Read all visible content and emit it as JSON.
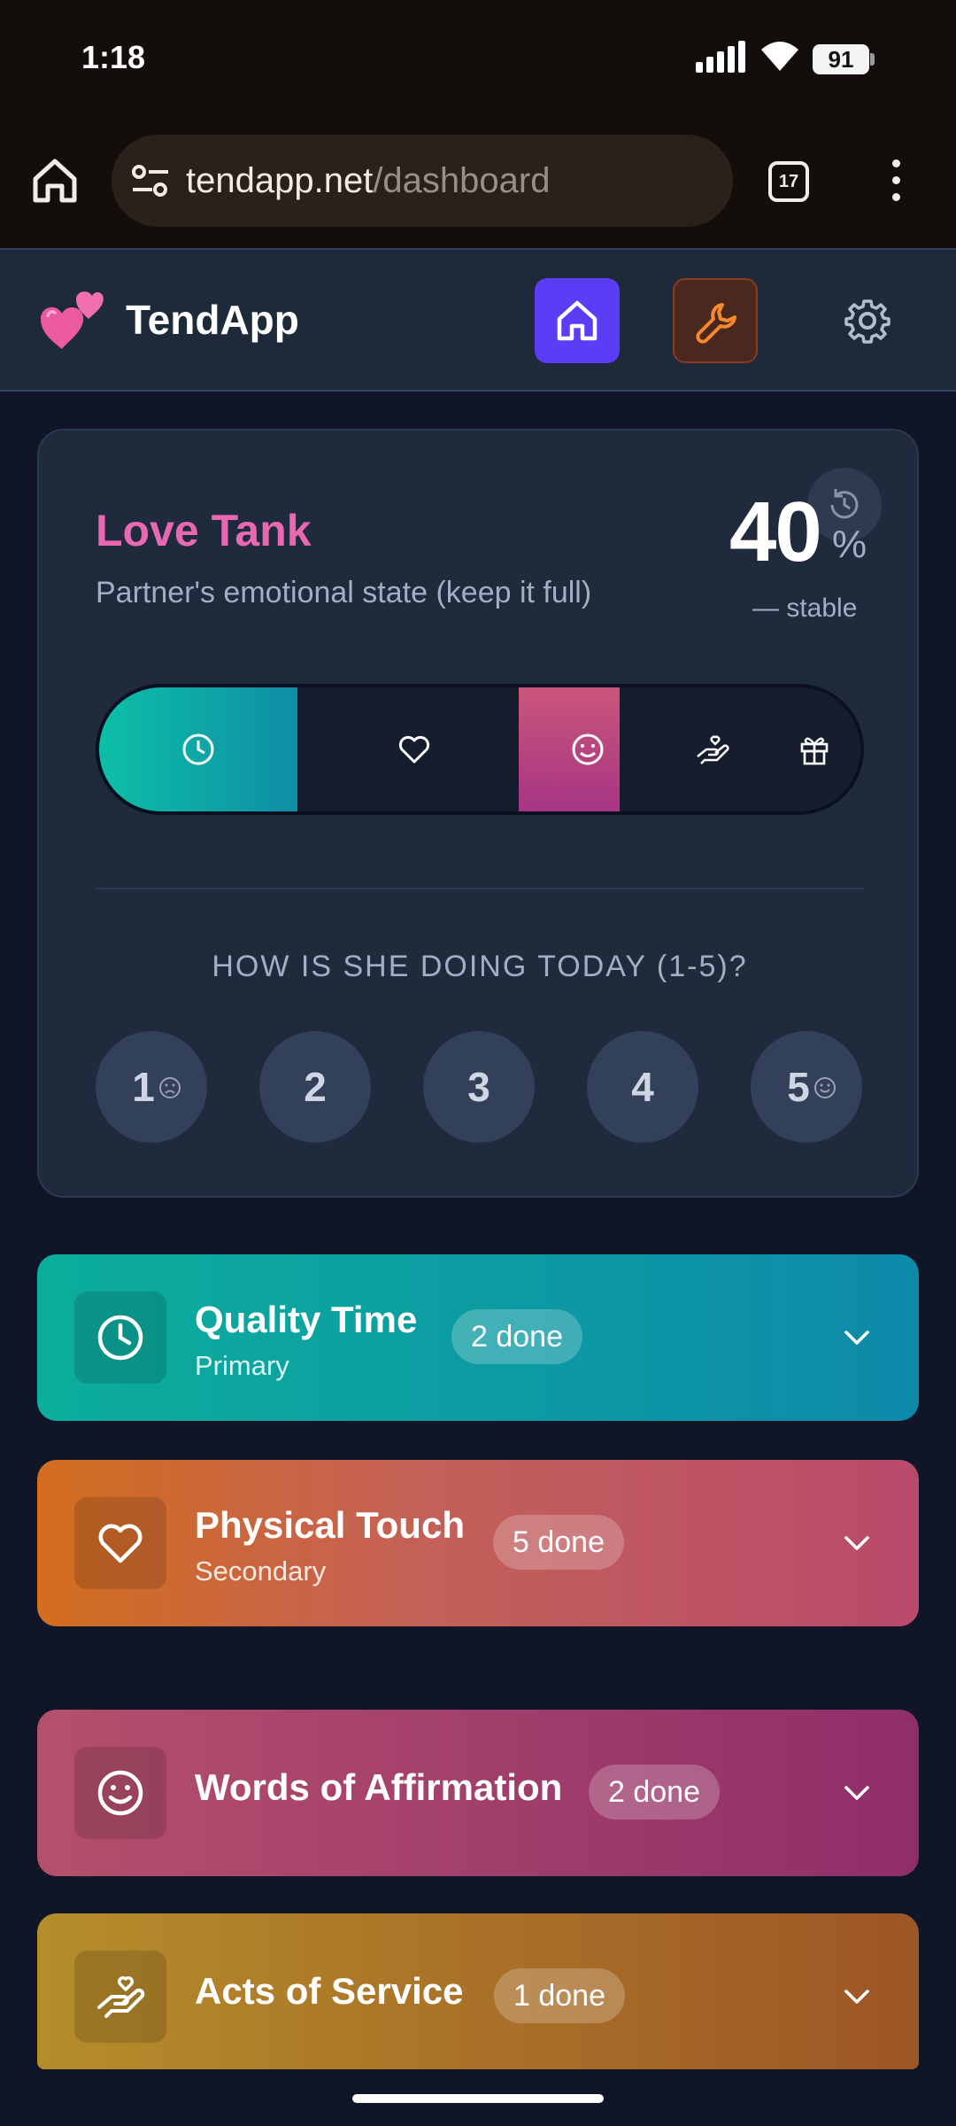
{
  "status_bar": {
    "time": "1:18",
    "battery": "91"
  },
  "browser": {
    "url_domain": "tendapp.net",
    "url_path": "/dashboard",
    "tab_count": "17"
  },
  "app": {
    "title": "TendApp"
  },
  "love_tank": {
    "title": "Love Tank",
    "subtitle": "Partner's emotional state (keep it full)",
    "percent": "40",
    "percent_sign": "%",
    "trend": "— stable",
    "fill_percent": 40,
    "rating_question": "HOW IS SHE DOING TODAY (1-5)?",
    "ratings": [
      "1",
      "2",
      "3",
      "4",
      "5"
    ]
  },
  "categories": [
    {
      "name": "Quality Time",
      "role": "Primary",
      "badge": "2 done",
      "icon": "clock-icon"
    },
    {
      "name": "Physical Touch",
      "role": "Secondary",
      "badge": "5 done",
      "icon": "heart-icon"
    },
    {
      "name": "Words of Affirmation",
      "role": "",
      "badge": "2 done",
      "icon": "smile-icon"
    },
    {
      "name": "Acts of Service",
      "role": "",
      "badge": "1 done",
      "icon": "helping-hand-icon"
    }
  ],
  "colors": {
    "accent_pink": "#e968b2",
    "home_button": "#5a3ef5",
    "quality_time": "#0cae9b",
    "physical_touch": "#d36e1f",
    "words_of_affirmation": "#b5506c",
    "acts_of_service": "#b58d2a"
  }
}
